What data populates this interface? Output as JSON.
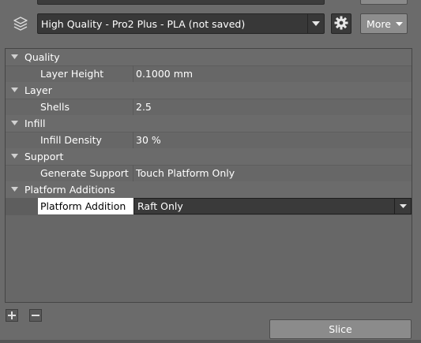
{
  "profile": {
    "selected_profile": "High Quality - Pro2 Plus - PLA (not saved)",
    "more_label": "More"
  },
  "settings": {
    "categories": [
      {
        "name": "Quality",
        "settings": [
          {
            "label": "Layer Height",
            "value": "0.1000 mm"
          }
        ]
      },
      {
        "name": "Layer",
        "settings": [
          {
            "label": "Shells",
            "value": "2.5"
          }
        ]
      },
      {
        "name": "Infill",
        "settings": [
          {
            "label": "Infill Density",
            "value": "30 %"
          }
        ]
      },
      {
        "name": "Support",
        "settings": [
          {
            "label": "Generate Support",
            "value": "Touch Platform Only"
          }
        ]
      },
      {
        "name": "Platform Additions",
        "settings": [
          {
            "label": "Platform Addition",
            "value": "Raft Only"
          }
        ]
      }
    ]
  },
  "footer": {
    "slice_label": "Slice"
  },
  "icons": {
    "layers": "layers-icon",
    "gear": "gear-icon",
    "dropdown": "chevron-down-icon",
    "expand": "triangle-down-icon",
    "add": "plus-icon",
    "remove": "minus-icon"
  },
  "colors": {
    "background": "#6b6b6b",
    "panel": "#676767",
    "combo": "#383838",
    "button": "#8b8b8b",
    "selected_label_bg": "#ffffff"
  }
}
